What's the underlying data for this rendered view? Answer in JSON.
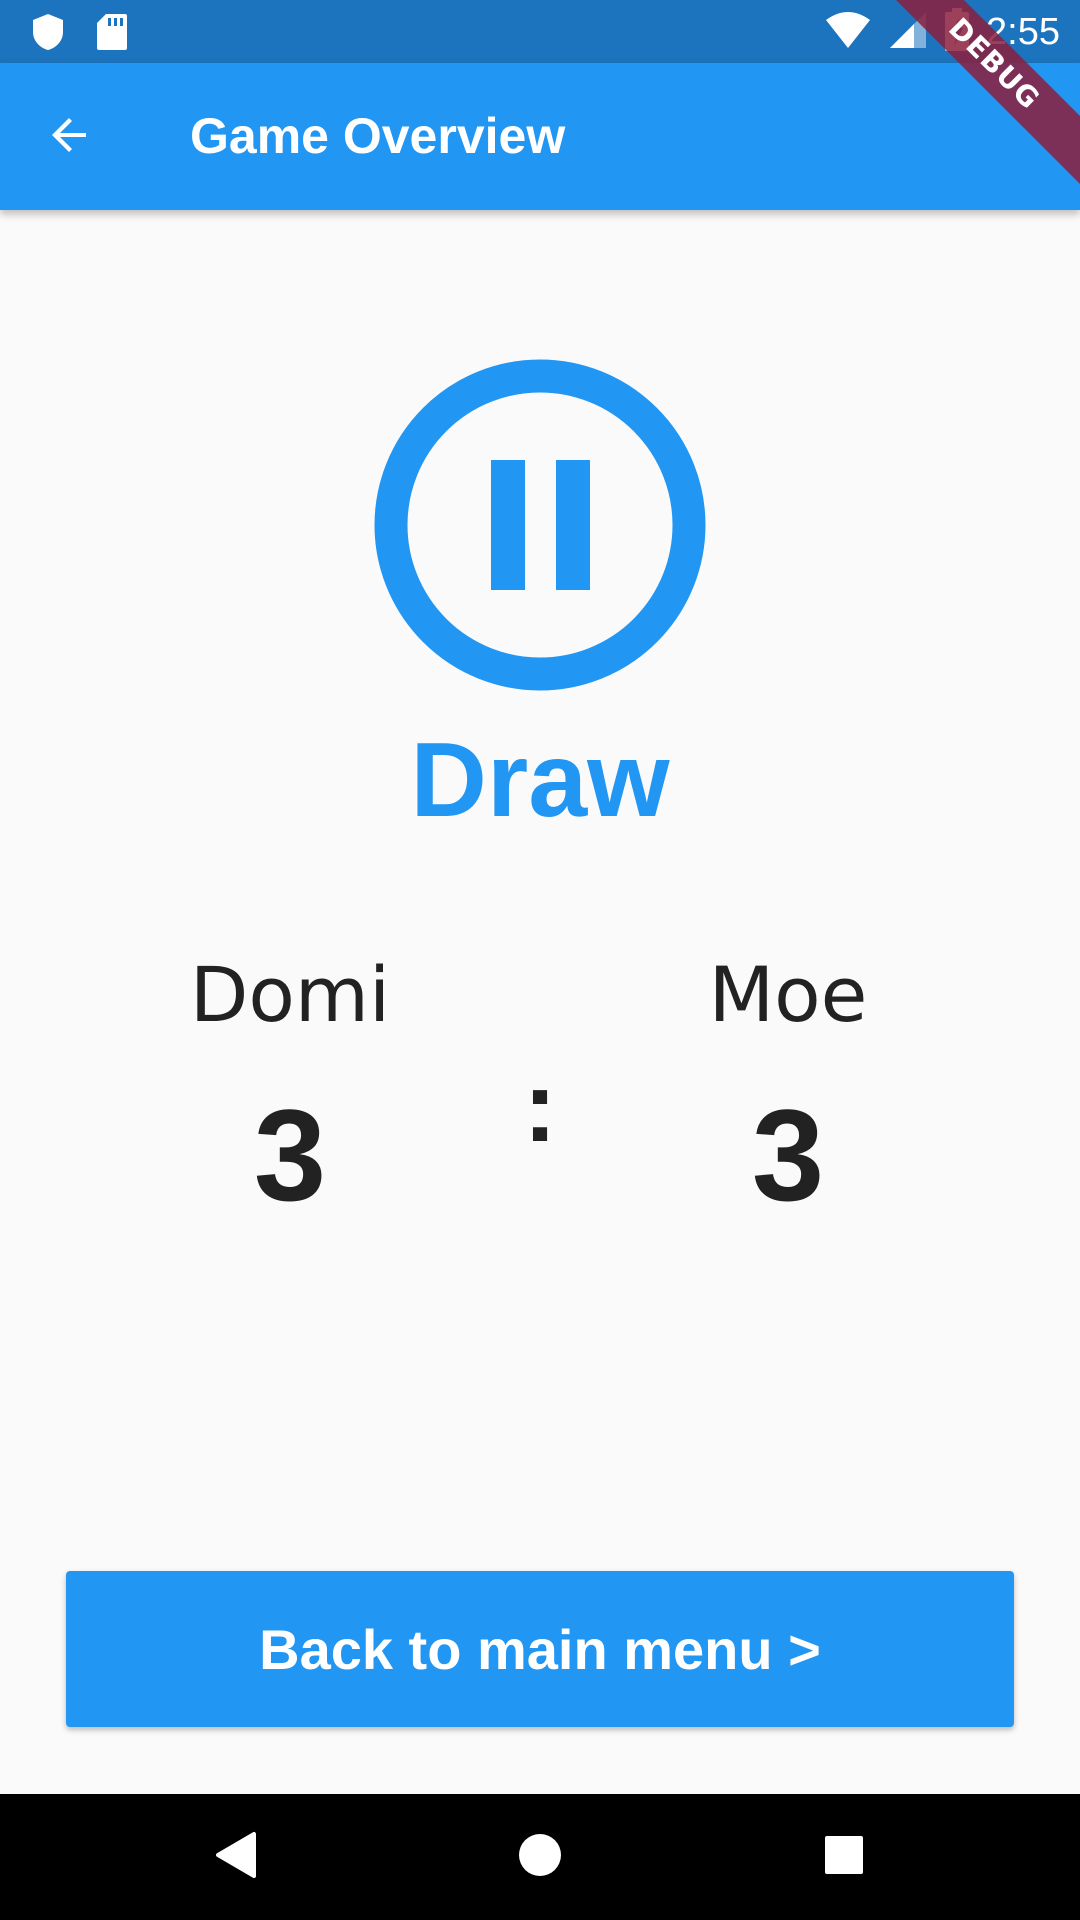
{
  "status_bar": {
    "time": "2:55",
    "icons": [
      "shield-icon",
      "sd-card-icon",
      "wifi-icon",
      "signal-icon",
      "battery-charging-icon"
    ]
  },
  "debug_banner": "DEBUG",
  "app_bar": {
    "title": "Game Overview",
    "back_icon": "arrow-back-icon"
  },
  "result": {
    "icon": "pause-circle-icon",
    "label": "Draw",
    "color": "#2196f3"
  },
  "scoreboard": {
    "players": [
      {
        "name": "Domi",
        "score": "3"
      },
      {
        "name": "Moe",
        "score": "3"
      }
    ],
    "separator": ":"
  },
  "actions": {
    "back_to_menu": "Back to main menu >"
  },
  "nav_bar": {
    "icons": [
      "nav-back-icon",
      "nav-home-icon",
      "nav-recents-icon"
    ]
  },
  "colors": {
    "primary": "#2196f3",
    "status_bar": "#1c74be",
    "background": "#fafafa",
    "text": "#222222"
  }
}
